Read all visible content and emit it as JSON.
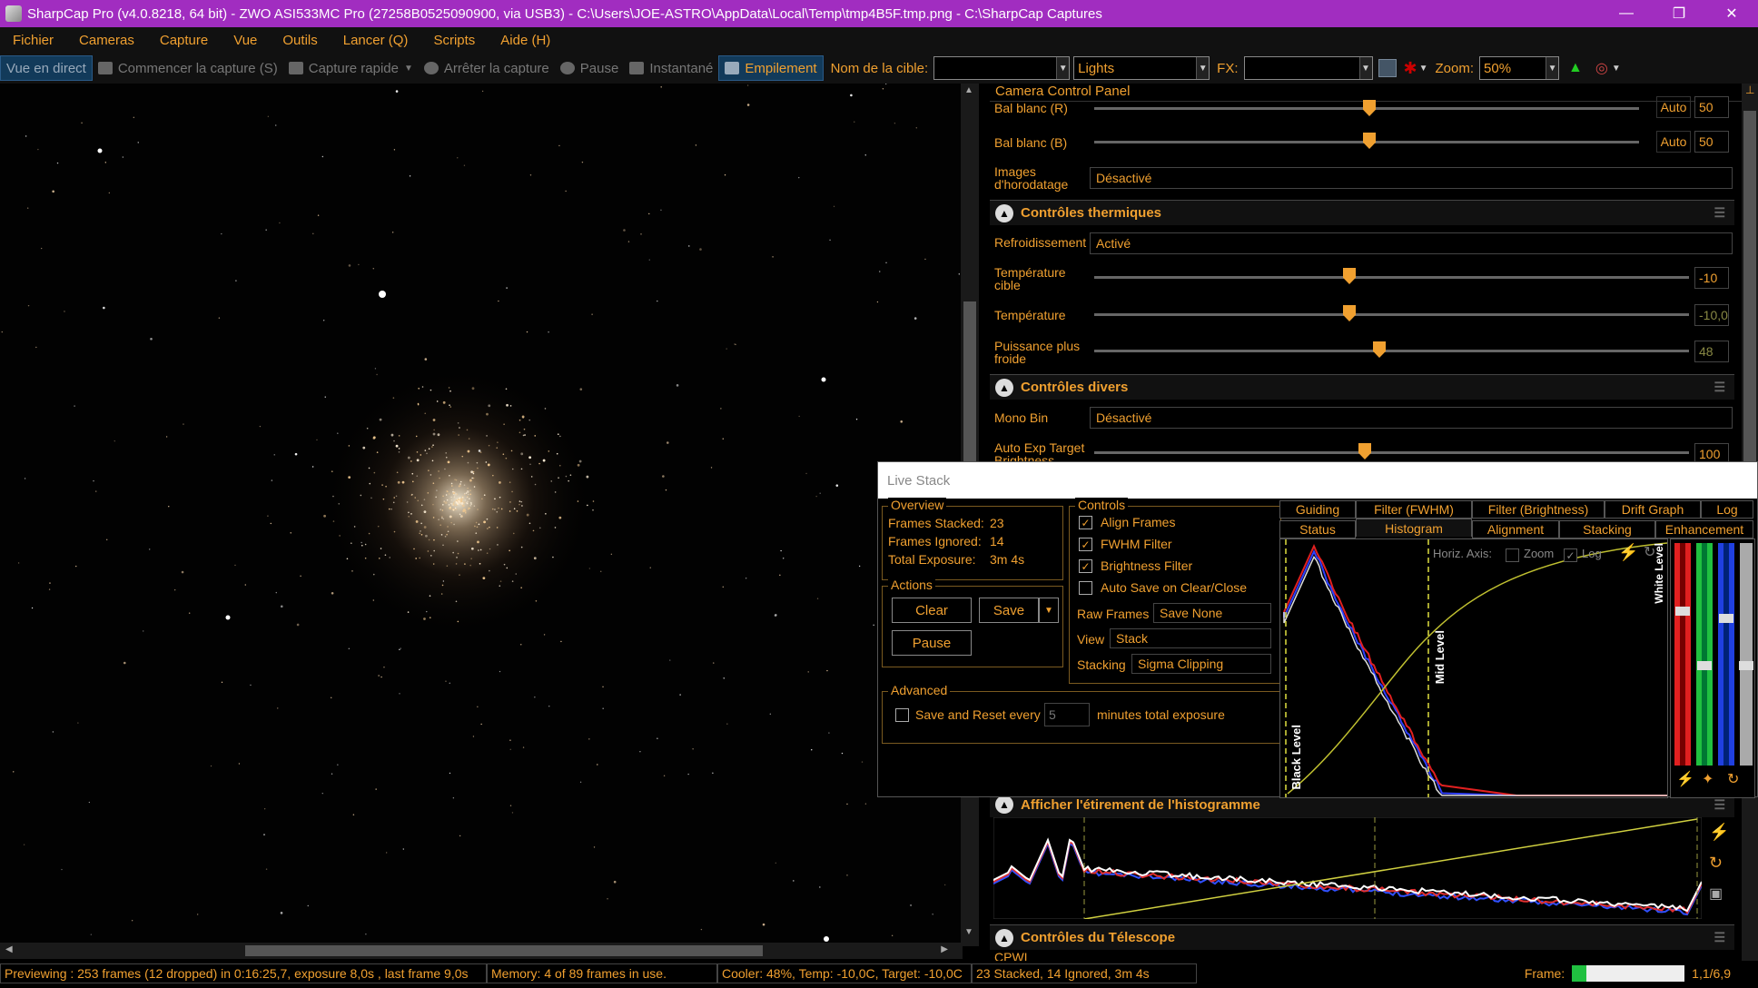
{
  "window": {
    "title": "SharpCap Pro (v4.0.8218, 64 bit) - ZWO ASI533MC Pro (27258B0525090900, via USB3) - C:\\Users\\JOE-ASTRO\\AppData\\Local\\Temp\\tmp4B5F.tmp.png - C:\\SharpCap Captures",
    "min": "—",
    "restore": "❐",
    "close": "✕"
  },
  "menu": [
    "Fichier",
    "Cameras",
    "Capture",
    "Vue",
    "Outils",
    "Lancer (Q)",
    "Scripts",
    "Aide (H)"
  ],
  "toolbar": {
    "live_view": "Vue en direct",
    "start_capture": "Commencer la capture (S)",
    "quick_capture": "Capture rapide",
    "stop_capture": "Arrêter la capture",
    "pause": "Pause",
    "snapshot": "Instantané",
    "stacking": "Empilement",
    "target_label": "Nom de la cible:",
    "target_value": "",
    "frame_type": "Lights",
    "fx_label": "FX:",
    "fx_value": "",
    "zoom_label": "Zoom:",
    "zoom_value": "50%"
  },
  "camera_panel": {
    "title": "Camera Control Panel",
    "wb_r": {
      "label": "Bal blanc (R)",
      "auto": "Auto",
      "value": "50",
      "level": 0.5
    },
    "wb_b": {
      "label": "Bal blanc (B)",
      "auto": "Auto",
      "value": "50",
      "level": 0.5
    },
    "timestamp": {
      "label": "Images d'horodatage",
      "value": "Désactivé"
    },
    "thermal": {
      "header": "Contrôles thermiques",
      "cooling": {
        "label": "Refroidissement",
        "value": "Activé"
      },
      "target_temp": {
        "label": "Température cible",
        "value": "-10",
        "level": 0.43
      },
      "temperature": {
        "label": "Température",
        "value": "-10,0",
        "level": 0.43
      },
      "cooler_power": {
        "label": "Puissance plus froide",
        "value": "48",
        "level": 0.48
      }
    },
    "misc": {
      "header": "Contrôles divers",
      "mono_bin": {
        "label": "Mono Bin",
        "value": "Désactivé"
      },
      "auto_exp": {
        "label": "Auto Exp Target Brightness",
        "value": "100",
        "level": 0.46
      }
    },
    "histo_stretch_header": "Afficher l'étirement de l'histogramme",
    "telescope_header": "Contrôles du Télescope",
    "telescope_sub": "CPWI"
  },
  "live_stack": {
    "title": "Live Stack",
    "overview": {
      "title": "Overview",
      "frames_stacked_label": "Frames Stacked:",
      "frames_stacked": "23",
      "frames_ignored_label": "Frames Ignored:",
      "frames_ignored": "14",
      "total_exposure_label": "Total Exposure:",
      "total_exposure": "3m 4s"
    },
    "actions": {
      "title": "Actions",
      "clear": "Clear",
      "save": "Save",
      "pause": "Pause"
    },
    "advanced": {
      "title": "Advanced",
      "save_reset": "Save and Reset every",
      "minutes_value": "5",
      "minutes_label": "minutes total exposure"
    },
    "controls": {
      "title": "Controls",
      "align_frames": "Align Frames",
      "fwhm_filter": "FWHM Filter",
      "brightness_filter": "Brightness Filter",
      "auto_save": "Auto Save on Clear/Close",
      "raw_frames_label": "Raw Frames",
      "raw_frames_value": "Save None",
      "view_label": "View",
      "view_value": "Stack",
      "stacking_label": "Stacking",
      "stacking_value": "Sigma Clipping"
    },
    "tabs_row1": [
      "Guiding",
      "Filter (FWHM)",
      "Filter (Brightness)",
      "Drift Graph",
      "Log"
    ],
    "tabs_row2": [
      "Status",
      "Histogram",
      "Alignment",
      "Stacking",
      "Enhancement"
    ],
    "histogram": {
      "horiz_axis": "Horiz. Axis:",
      "zoom": "Zoom",
      "log": "Log",
      "black_level": "Black Level",
      "mid_level": "Mid Level",
      "white_level": "White Level"
    }
  },
  "status": {
    "preview": "Previewing : 253 frames (12 dropped) in 0:16:25,7, exposure 8,0s , last frame 9,0s",
    "memory": "Memory: 4 of 89 frames in use.",
    "cooler": "Cooler: 48%, Temp: -10,0C, Target: -10,0C",
    "stack": "23 Stacked, 14 Ignored, 3m 4s",
    "frame_label": "Frame:",
    "frame_value": "1,1/6,9"
  },
  "colors": {
    "accent": "#f0a030",
    "titlebar": "#a12dc0",
    "red": "#e02020",
    "green": "#20c040",
    "blue": "#2040e0",
    "yellow": "#d0d040"
  }
}
